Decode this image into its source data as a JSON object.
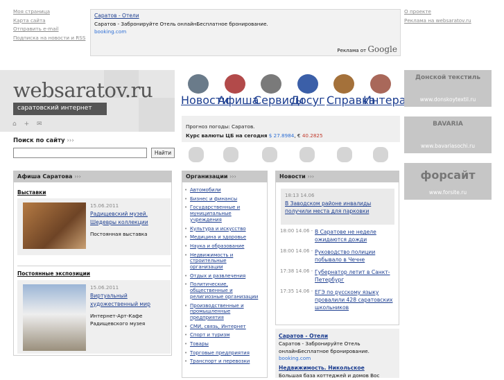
{
  "top_nav": [
    "Моя страница",
    "Карта сайта",
    "Отправить e-mail",
    "Подписка на новости и RSS"
  ],
  "top_right": [
    "О проекте",
    "Реклама на websaratov.ru"
  ],
  "top_ad": {
    "title": "Саратов - Отели",
    "desc": "Саратов - Забронируйте Отель онлайнБесплатное бронирование.",
    "url": "booking.com",
    "adby_prefix": "Реклама от",
    "adby_brand": "Google"
  },
  "logo": {
    "name": "websaratov.ru",
    "tagline": "саратовский интернет",
    "icons": "⌂ + ✉"
  },
  "categories": [
    {
      "label": "Новости",
      "icon": "news-icon",
      "color": "#6a7b8a"
    },
    {
      "label": "Афиша",
      "icon": "afisha-icon",
      "color": "#b24a4a"
    },
    {
      "label": "Сервисы",
      "icon": "services-icon",
      "color": "#7a7a7a"
    },
    {
      "label": "Досуг",
      "icon": "leisure-icon",
      "color": "#3b5fa8"
    },
    {
      "label": "Справка",
      "icon": "reference-icon",
      "color": "#a4713a"
    },
    {
      "label": "Интерактив",
      "icon": "interactive-icon",
      "color": "#a9685a"
    }
  ],
  "info": {
    "weather": "Прогноз погоды: Саратов.",
    "rates_label": "Курс валюты ЦБ на сегодня",
    "usd": "$ 27.8984",
    "eur_sign": ", €",
    "eur": "40.2825"
  },
  "gray_icons": [
    "car-icon",
    "building-icon",
    "medical-icon",
    "bank-icon",
    "sport-icon",
    "flower-icon"
  ],
  "search": {
    "label": "Поиск по сайту",
    "arrows": "›››",
    "button": "Найти",
    "value": ""
  },
  "afisha": {
    "header": "Афиша Саратова",
    "sections": [
      {
        "title": "Выставки",
        "date": "15.06.2011",
        "link": "Радищевский музей. Шедевры коллекции",
        "note": "Постоянная выставка"
      },
      {
        "title": "Постоянные экспозиции",
        "date": "15.06.2011",
        "link": "Виртуальный художественный мир",
        "note": "Интернет-Арт-Кафе Радищевского музея"
      }
    ]
  },
  "orgs": {
    "header": "Организации",
    "items": [
      "Автомобили",
      "Бизнес и финансы",
      "Государственные и муниципальные учреждения",
      "Культура и искусство",
      "Медицина и здоровье",
      "Наука и образование",
      "Недвижимость и строительные организации",
      "Отдых и развлечения",
      "Политические, общественные и религиозные организации",
      "Производственные и промышленные предприятия",
      "СМИ, связь, Интернет",
      "Спорт и туризм",
      "Товары",
      "Торговые предприятия",
      "Транспорт и перевозки"
    ]
  },
  "news": {
    "header": "Новости",
    "highlight": {
      "time": "18:13 14.06",
      "text": "В Заводском районе инвалиды получили места для парковки"
    },
    "items": [
      {
        "time": "18:00 14.06 -",
        "text": "В Саратове не неделе ожидаются дожди"
      },
      {
        "time": "18:00 14.06 -",
        "text": "Руководство полиции побывало в Чечне"
      },
      {
        "time": "17:38 14.06 -",
        "text": "Губернатор летит в Санкт-Петербург"
      },
      {
        "time": "17:35 14.06 -",
        "text": "ЕГЭ по русскому языку провалили 428 саратовских школьников"
      }
    ]
  },
  "ad2": {
    "title": "Саратов - Отели",
    "desc": "Саратов - Забронируйте Отель онлайнБесплатное бронирование.",
    "url": "booking.com",
    "title2": "Недвижимость. Никольское",
    "desc2": "Большая база коттеджей и домов Вос"
  },
  "banners": [
    {
      "logo": "Донской текстиль",
      "url": "www.donskoytextil.ru"
    },
    {
      "logo": "BAVARIA",
      "url": "www.bavariasochi.ru"
    },
    {
      "logo": "форсайт",
      "url": "www.forsite.ru"
    }
  ]
}
